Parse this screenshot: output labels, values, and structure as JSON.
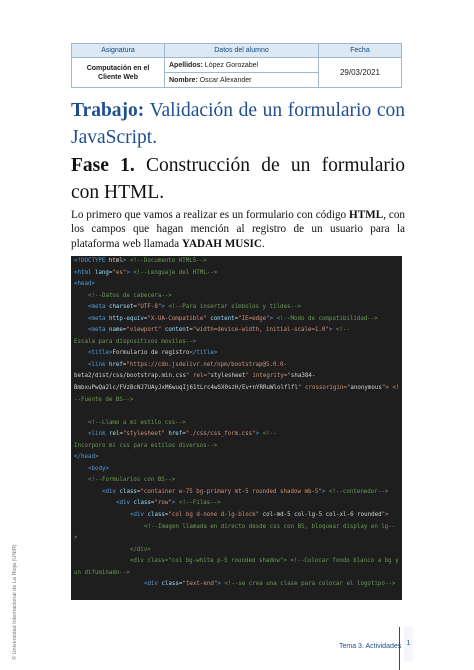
{
  "header": {
    "col_subject": "Asignatura",
    "col_student": "Datos del alumno",
    "col_date": "Fecha",
    "course_name": "Computación en el Cliente Web",
    "surname_label": "Apellidos:",
    "surname_value": "López Gorozabel",
    "name_label": "Nombre:",
    "name_value": "Oscar Alexander",
    "date_value": "29/03/2021"
  },
  "title": {
    "label": "Trabajo:",
    "text": "Validación de un formulario con JavaScript."
  },
  "phase": {
    "label": "Fase 1.",
    "text": "Construcción de un formulario con HTML."
  },
  "intro": {
    "part1": "Lo primero que vamos a realizar es un formulario con código ",
    "bold1": "HTML",
    "part2": ", con los campos que hagan mención al registro de un usuario para la plataforma web llamada ",
    "bold2": "YADAH MUSIC",
    "part3": "."
  },
  "code_lines": [
    "<!DOCTYPE html> <!--Documento HTML5-->",
    "<html lang=\"es\"> <!--Lenguaje del HTML-->",
    "<head>",
    "    <!--Datos de cabecera-->",
    "    <meta charset=\"UTF-8\"> <!--Para insertar símbolos y tildes-->",
    "    <meta http-equiv=\"X-UA-Compatible\" content=\"IE=edge\"> <!--Modo de compatibilidad-->",
    "    <meta name=\"viewport\" content=\"width=device-width, initial-scale=1.0\"> <!--",
    "Escala para dispositivos moviles-->",
    "    <title>Formulario de registro</title>",
    "    <link href=\"https://cdn.jsdelivr.net/npm/bootstrap@5.0.0-",
    "beta2/dist/css/bootstrap.min.css\" rel=\"stylesheet\" integrity=\"sha384-",
    "BmbxuPwQa2lc/FVzBcNJ7UAyJxM6wuqIj61tLrc4wSX0szH/Ev+nYRRuWlolflfl\" crossorigin=\"anonymous\"> <!",
    "--Fuente de BS-->",
    "",
    "    <!--Llamo a mi estilo css-->",
    "    <link rel=\"stylesheet\" href=\"./css/css_form.css\"> <!--",
    "Incorporo mi css para estilos diversos-->",
    "</head>",
    "    <body>",
    "    <!--Formularios con BS-->",
    "        <div class=\"container w-75 bg-primary mt-5 rounded shadow mb-5\"> <!--contenedor-->",
    "            <div class=\"row\"> <!--Filas-->",
    "                <div class=\"col bg d-none d-lg-block\" col-md-5 col-lg-5 col-xl-6 rounded\">",
    "                    <!--Imagen llamada en directo desde css con BS, bloquear display en lg--",
    ">",
    "                </div>",
    "",
    "                <div class=\"col bg-white p-5 rounded shadow\"> <!--Colocar fondo blanco a bg y",
    "un difuminado-->",
    "                    <div class=\"text-end\"> <!--se crea una clase para colocar el logotipo-->"
  ],
  "side_notice": "© Universidad Internacional de La Rioja (UNIR)",
  "footer": {
    "section": "Tema 3. Actividades",
    "page": "1"
  }
}
